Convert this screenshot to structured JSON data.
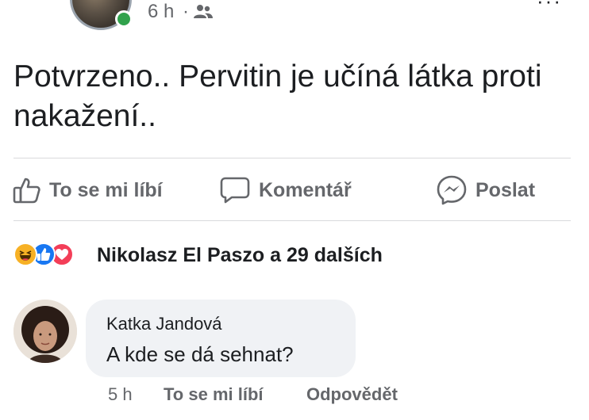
{
  "post": {
    "time": "6 h",
    "separator": "·",
    "audience_icon": "friends-icon",
    "text": "Potvrzeno.. Pervitin je učíná látka proti nakažení.."
  },
  "actions": {
    "like_label": "To se mi líbí",
    "comment_label": "Komentář",
    "share_label": "Poslat"
  },
  "reactions": {
    "icons": [
      "haha-icon",
      "like-icon",
      "love-icon"
    ],
    "summary": "Nikolasz El Paszo a 29 dalších"
  },
  "comment": {
    "author": "Katka Jandová",
    "text": "A kde se dá sehnat?",
    "time": "5 h",
    "like_label": "To se mi líbí",
    "reply_label": "Odpovědět"
  },
  "colors": {
    "online": "#31a24c",
    "like": "#1877f2",
    "love": "#f33e58",
    "haha": "#f7b125",
    "secondary_text": "#65676b"
  }
}
